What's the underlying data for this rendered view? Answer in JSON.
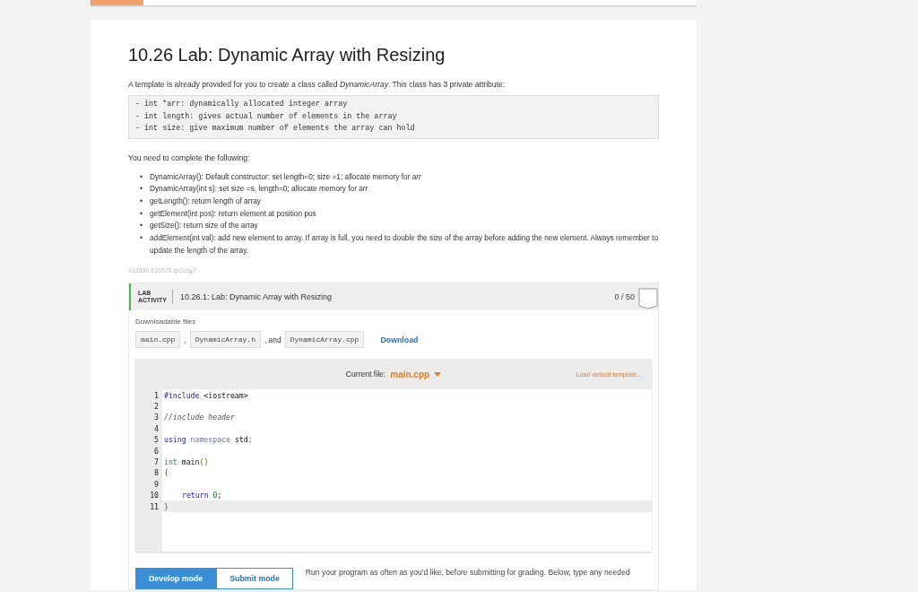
{
  "title": "10.26 Lab: Dynamic Array with Resizing",
  "intro": "A template is already provided for you to create a class called *DynamicArray*. This class has 3 private attribute:",
  "attributes": [
    "- int *arr: dynamically allocated integer array",
    "- int length: gives actual number of elements in the array",
    "- int size: give maximum number of elements the array can hold"
  ],
  "tasks_intro": "You need to complete the following:",
  "tasks": [
    {
      "marker": "•",
      "text": "DynamicArray(): Default constructor: set length=0; size =1; allocate memory for *arr*"
    },
    {
      "marker": "•",
      "text": "DynamicArray(int s): set size =s, length=0; allocate memory for *arr*"
    },
    {
      "marker": "•",
      "text": "getLength(): return length of array"
    },
    {
      "marker": "•",
      "text": "getElement(int pos): return element at position pos"
    },
    {
      "marker": "•",
      "text": "getSize(): return size of the array"
    },
    {
      "marker": "•",
      "text": "addElement(int val): add new element to array. If array is full, you need to double the size of the array before adding the new element. Always remember to update the length of the array."
    }
  ],
  "activity_id": "413530.616576.qx3zqy7",
  "lab": {
    "tag_line_1": "LAB",
    "tag_line_2": "ACTIVITY",
    "name": "10.26.1: Lab: Dynamic Array with Resizing",
    "score": "0 / 50",
    "files_label": "Downloadable files",
    "files": [
      {
        "kind": "file",
        "text": "main.cpp"
      },
      {
        "kind": "sep",
        "text": ","
      },
      {
        "kind": "file",
        "text": "DynamicArray.h"
      },
      {
        "kind": "sep",
        "text": ", and"
      },
      {
        "kind": "file",
        "text": "DynamicArray.cpp"
      }
    ],
    "download": "Download",
    "current_file_label": "Current file:",
    "current_file": "main.cpp",
    "load_template": "Load default template...",
    "code": [
      {
        "number": "1",
        "active": false,
        "tokens": [
          {
            "kind": "keyword",
            "text": "#include"
          },
          {
            "kind": "plain",
            "text": " <iostream>"
          }
        ]
      },
      {
        "number": "2",
        "active": false
      },
      {
        "number": "3",
        "active": false,
        "tokens": [
          {
            "kind": "comment",
            "text": "//include header"
          }
        ]
      },
      {
        "number": "4",
        "active": false
      },
      {
        "number": "5",
        "active": false,
        "tokens": [
          {
            "kind": "keyword",
            "text": "using"
          },
          {
            "kind": "muted",
            "text": " namespace"
          },
          {
            "kind": "plain",
            "text": " std"
          },
          {
            "kind": "punct",
            "text": ";"
          }
        ]
      },
      {
        "number": "6",
        "active": false
      },
      {
        "number": "7",
        "active": false,
        "tokens": [
          {
            "kind": "type",
            "text": "int"
          },
          {
            "kind": "plain",
            "text": " main"
          },
          {
            "kind": "punct",
            "text": "()"
          }
        ]
      },
      {
        "number": "8",
        "active": false,
        "tokens": [
          {
            "kind": "punct",
            "text": "{"
          }
        ]
      },
      {
        "number": "9",
        "active": false
      },
      {
        "number": "10",
        "active": false,
        "indented": true,
        "tokens": [
          {
            "kind": "keyword",
            "text": "return"
          },
          {
            "kind": "number",
            "text": " 0"
          },
          {
            "kind": "plain",
            "text": ";"
          }
        ]
      },
      {
        "number": "11",
        "active": true,
        "tokens": [
          {
            "kind": "punct",
            "text": "}"
          }
        ]
      }
    ],
    "modes": [
      {
        "label": "Develop mode",
        "selected": true
      },
      {
        "label": "Submit mode",
        "selected": false
      }
    ],
    "mode_help": "Run your program as often as you'd like, before submitting for grading. Below, type any needed"
  }
}
